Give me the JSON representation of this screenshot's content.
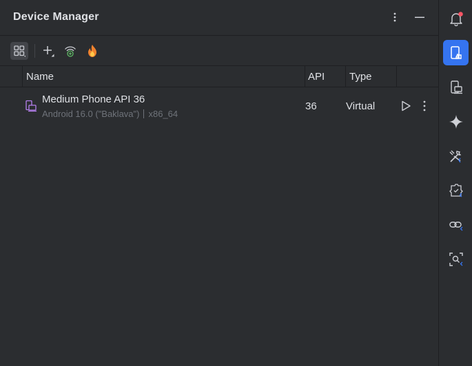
{
  "window": {
    "title": "Device Manager"
  },
  "toolbar": {
    "items": [
      {
        "icon": "device-groups-icon"
      },
      {
        "icon": "add-device-icon"
      },
      {
        "icon": "pair-wireless-icon"
      },
      {
        "icon": "firebase-icon"
      }
    ]
  },
  "table": {
    "columns": [
      "Name",
      "API",
      "Type"
    ],
    "rows": [
      {
        "name": "Medium Phone API 36",
        "subtitle_os": "Android 16.0 (\"Baklava\")",
        "subtitle_arch": "x86_64",
        "api": "36",
        "type": "Virtual"
      }
    ]
  },
  "stripe": {
    "items": [
      {
        "icon": "notifications-icon",
        "badge": true
      },
      {
        "icon": "device-manager-icon",
        "selected": true
      },
      {
        "icon": "running-devices-icon"
      },
      {
        "icon": "gemini-icon"
      },
      {
        "icon": "build-tools-icon"
      },
      {
        "icon": "app-quality-insights-icon"
      },
      {
        "icon": "app-links-icon"
      },
      {
        "icon": "layout-inspector-icon"
      }
    ]
  },
  "colors": {
    "background": "#2b2d30",
    "accent": "#3574f0",
    "text": "#dfe1e5",
    "muted": "#6f737a",
    "device_icon": "#b681f0",
    "badge": "#f75464",
    "firebase": "#f0822e"
  }
}
